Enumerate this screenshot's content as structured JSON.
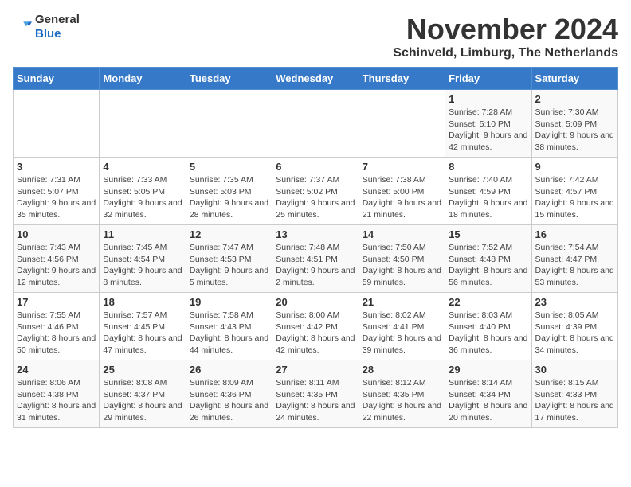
{
  "logo": {
    "text_general": "General",
    "text_blue": "Blue"
  },
  "header": {
    "month_year": "November 2024",
    "location": "Schinveld, Limburg, The Netherlands"
  },
  "days_of_week": [
    "Sunday",
    "Monday",
    "Tuesday",
    "Wednesday",
    "Thursday",
    "Friday",
    "Saturday"
  ],
  "weeks": [
    [
      {
        "day": "",
        "info": ""
      },
      {
        "day": "",
        "info": ""
      },
      {
        "day": "",
        "info": ""
      },
      {
        "day": "",
        "info": ""
      },
      {
        "day": "",
        "info": ""
      },
      {
        "day": "1",
        "info": "Sunrise: 7:28 AM\nSunset: 5:10 PM\nDaylight: 9 hours and 42 minutes."
      },
      {
        "day": "2",
        "info": "Sunrise: 7:30 AM\nSunset: 5:09 PM\nDaylight: 9 hours and 38 minutes."
      }
    ],
    [
      {
        "day": "3",
        "info": "Sunrise: 7:31 AM\nSunset: 5:07 PM\nDaylight: 9 hours and 35 minutes."
      },
      {
        "day": "4",
        "info": "Sunrise: 7:33 AM\nSunset: 5:05 PM\nDaylight: 9 hours and 32 minutes."
      },
      {
        "day": "5",
        "info": "Sunrise: 7:35 AM\nSunset: 5:03 PM\nDaylight: 9 hours and 28 minutes."
      },
      {
        "day": "6",
        "info": "Sunrise: 7:37 AM\nSunset: 5:02 PM\nDaylight: 9 hours and 25 minutes."
      },
      {
        "day": "7",
        "info": "Sunrise: 7:38 AM\nSunset: 5:00 PM\nDaylight: 9 hours and 21 minutes."
      },
      {
        "day": "8",
        "info": "Sunrise: 7:40 AM\nSunset: 4:59 PM\nDaylight: 9 hours and 18 minutes."
      },
      {
        "day": "9",
        "info": "Sunrise: 7:42 AM\nSunset: 4:57 PM\nDaylight: 9 hours and 15 minutes."
      }
    ],
    [
      {
        "day": "10",
        "info": "Sunrise: 7:43 AM\nSunset: 4:56 PM\nDaylight: 9 hours and 12 minutes."
      },
      {
        "day": "11",
        "info": "Sunrise: 7:45 AM\nSunset: 4:54 PM\nDaylight: 9 hours and 8 minutes."
      },
      {
        "day": "12",
        "info": "Sunrise: 7:47 AM\nSunset: 4:53 PM\nDaylight: 9 hours and 5 minutes."
      },
      {
        "day": "13",
        "info": "Sunrise: 7:48 AM\nSunset: 4:51 PM\nDaylight: 9 hours and 2 minutes."
      },
      {
        "day": "14",
        "info": "Sunrise: 7:50 AM\nSunset: 4:50 PM\nDaylight: 8 hours and 59 minutes."
      },
      {
        "day": "15",
        "info": "Sunrise: 7:52 AM\nSunset: 4:48 PM\nDaylight: 8 hours and 56 minutes."
      },
      {
        "day": "16",
        "info": "Sunrise: 7:54 AM\nSunset: 4:47 PM\nDaylight: 8 hours and 53 minutes."
      }
    ],
    [
      {
        "day": "17",
        "info": "Sunrise: 7:55 AM\nSunset: 4:46 PM\nDaylight: 8 hours and 50 minutes."
      },
      {
        "day": "18",
        "info": "Sunrise: 7:57 AM\nSunset: 4:45 PM\nDaylight: 8 hours and 47 minutes."
      },
      {
        "day": "19",
        "info": "Sunrise: 7:58 AM\nSunset: 4:43 PM\nDaylight: 8 hours and 44 minutes."
      },
      {
        "day": "20",
        "info": "Sunrise: 8:00 AM\nSunset: 4:42 PM\nDaylight: 8 hours and 42 minutes."
      },
      {
        "day": "21",
        "info": "Sunrise: 8:02 AM\nSunset: 4:41 PM\nDaylight: 8 hours and 39 minutes."
      },
      {
        "day": "22",
        "info": "Sunrise: 8:03 AM\nSunset: 4:40 PM\nDaylight: 8 hours and 36 minutes."
      },
      {
        "day": "23",
        "info": "Sunrise: 8:05 AM\nSunset: 4:39 PM\nDaylight: 8 hours and 34 minutes."
      }
    ],
    [
      {
        "day": "24",
        "info": "Sunrise: 8:06 AM\nSunset: 4:38 PM\nDaylight: 8 hours and 31 minutes."
      },
      {
        "day": "25",
        "info": "Sunrise: 8:08 AM\nSunset: 4:37 PM\nDaylight: 8 hours and 29 minutes."
      },
      {
        "day": "26",
        "info": "Sunrise: 8:09 AM\nSunset: 4:36 PM\nDaylight: 8 hours and 26 minutes."
      },
      {
        "day": "27",
        "info": "Sunrise: 8:11 AM\nSunset: 4:35 PM\nDaylight: 8 hours and 24 minutes."
      },
      {
        "day": "28",
        "info": "Sunrise: 8:12 AM\nSunset: 4:35 PM\nDaylight: 8 hours and 22 minutes."
      },
      {
        "day": "29",
        "info": "Sunrise: 8:14 AM\nSunset: 4:34 PM\nDaylight: 8 hours and 20 minutes."
      },
      {
        "day": "30",
        "info": "Sunrise: 8:15 AM\nSunset: 4:33 PM\nDaylight: 8 hours and 17 minutes."
      }
    ]
  ]
}
